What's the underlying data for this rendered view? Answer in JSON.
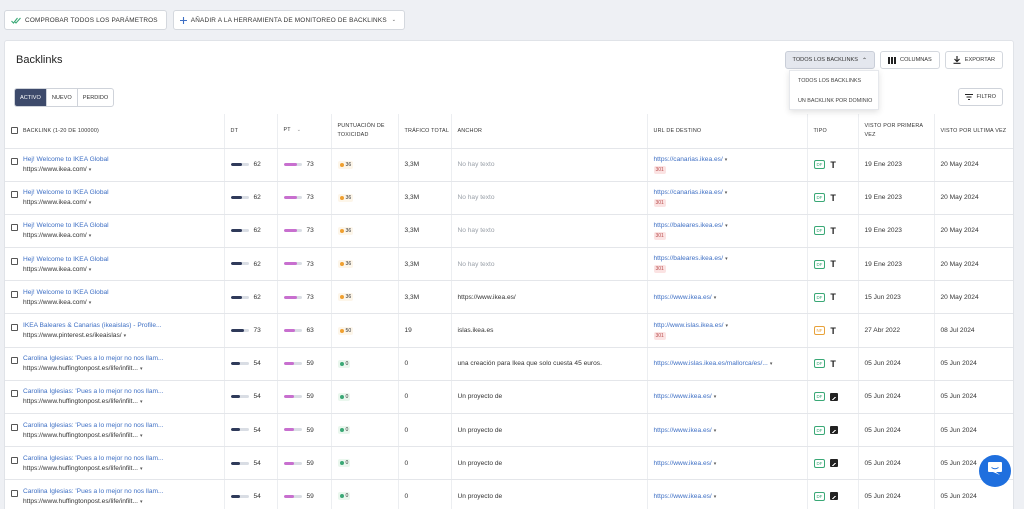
{
  "toolbar": {
    "check_params": "Comprobar todos los parámetros",
    "add_monitor": "Añadir a la herramienta de monitoreo de backlinks"
  },
  "header": {
    "title": "Backlinks",
    "all_backlinks": "Todos los backlinks",
    "columns": "Columnas",
    "export": "Exportar"
  },
  "dropdown": {
    "items": [
      "Todos los backlinks",
      "Un backlink por dominio"
    ]
  },
  "tabs": [
    "Activo",
    "Nuevo",
    "Perdido"
  ],
  "filter_label": "Filtro",
  "columns": {
    "backlink": "Backlink (1-20 de 100000)",
    "dt": "DT",
    "pt": "PT",
    "toxicity": "Puntuación de toxicidad",
    "traffic": "Tráfico total",
    "anchor": "Anchor",
    "target": "URL de destino",
    "type": "Tipo",
    "first_seen": "Visto por primera vez",
    "last_seen": "Visto por ultima vez"
  },
  "colors": {
    "accent": "#3d4a6b",
    "link": "#3e6fc4",
    "dt_bar": "#2f3a5a",
    "pt_bar": "#c86fcf",
    "tox_orange": "#f0a030",
    "tox_green": "#3aa876",
    "chat": "#1f6fde"
  },
  "rows": [
    {
      "title": "Hej! Welcome to IKEA Global",
      "url": "https://www.ikea.com/",
      "dt": "62",
      "dt_level": 0.62,
      "pt": "73",
      "pt_level": 0.73,
      "tox": "36",
      "tox_color": "orange",
      "traffic": "3,3M",
      "anchor": "No hay texto",
      "anchor_muted": true,
      "target": "https://canarias.ikea.es/",
      "redirect": "301",
      "df": "DF",
      "nofollow": false,
      "icon": "text-icon",
      "first": "19 Ene 2023",
      "last": "20 May 2024"
    },
    {
      "title": "Hej! Welcome to IKEA Global",
      "url": "https://www.ikea.com/",
      "dt": "62",
      "dt_level": 0.62,
      "pt": "73",
      "pt_level": 0.73,
      "tox": "36",
      "tox_color": "orange",
      "traffic": "3,3M",
      "anchor": "No hay texto",
      "anchor_muted": true,
      "target": "https://canarias.ikea.es/",
      "redirect": "301",
      "df": "DF",
      "nofollow": false,
      "icon": "text-icon",
      "first": "19 Ene 2023",
      "last": "20 May 2024"
    },
    {
      "title": "Hej! Welcome to IKEA Global",
      "url": "https://www.ikea.com/",
      "dt": "62",
      "dt_level": 0.62,
      "pt": "73",
      "pt_level": 0.73,
      "tox": "36",
      "tox_color": "orange",
      "traffic": "3,3M",
      "anchor": "No hay texto",
      "anchor_muted": true,
      "target": "https://baleares.ikea.es/",
      "redirect": "301",
      "df": "DF",
      "nofollow": false,
      "icon": "text-icon",
      "first": "19 Ene 2023",
      "last": "20 May 2024"
    },
    {
      "title": "Hej! Welcome to IKEA Global",
      "url": "https://www.ikea.com/",
      "dt": "62",
      "dt_level": 0.62,
      "pt": "73",
      "pt_level": 0.73,
      "tox": "36",
      "tox_color": "orange",
      "traffic": "3,3M",
      "anchor": "No hay texto",
      "anchor_muted": true,
      "target": "https://baleares.ikea.es/",
      "redirect": "301",
      "df": "DF",
      "nofollow": false,
      "icon": "text-icon",
      "first": "19 Ene 2023",
      "last": "20 May 2024"
    },
    {
      "title": "Hej! Welcome to IKEA Global",
      "url": "https://www.ikea.com/",
      "dt": "62",
      "dt_level": 0.62,
      "pt": "73",
      "pt_level": 0.73,
      "tox": "36",
      "tox_color": "orange",
      "traffic": "3,3M",
      "anchor": "https://www.ikea.es/",
      "anchor_muted": false,
      "target": "https://www.ikea.es/",
      "redirect": "",
      "df": "DF",
      "nofollow": false,
      "icon": "text-icon",
      "first": "15 Jun 2023",
      "last": "20 May 2024"
    },
    {
      "title": "IKEA Baleares & Canarias (ikeaislas) - Profile...",
      "url": "https://www.pinterest.es/ikeaislas/",
      "dt": "73",
      "dt_level": 0.73,
      "pt": "63",
      "pt_level": 0.63,
      "tox": "50",
      "tox_color": "orange",
      "traffic": "19",
      "anchor": "islas.ikea.es",
      "anchor_muted": false,
      "target": "http://www.islas.ikea.es/",
      "redirect": "301",
      "df": "NF",
      "nofollow": true,
      "icon": "text-icon",
      "first": "27 Abr 2022",
      "last": "08 Jul 2024"
    },
    {
      "title": "Carolina Iglesias: 'Pues a lo mejor no nos llam...",
      "url": "https://www.huffingtonpost.es/life/infilt...",
      "dt": "54",
      "dt_level": 0.54,
      "pt": "59",
      "pt_level": 0.59,
      "tox": "0",
      "tox_color": "green",
      "traffic": "0",
      "anchor": "una creación para Ikea que solo cuesta 45 euros.",
      "anchor_muted": false,
      "target": "https://www.islas.ikea.es/mallorca/es/...",
      "redirect": "",
      "df": "DF",
      "nofollow": false,
      "icon": "text-icon",
      "first": "05 Jun 2024",
      "last": "05 Jun 2024"
    },
    {
      "title": "Carolina Iglesias: 'Pues a lo mejor no nos llam...",
      "url": "https://www.huffingtonpost.es/life/infilt...",
      "dt": "54",
      "dt_level": 0.54,
      "pt": "59",
      "pt_level": 0.59,
      "tox": "0",
      "tox_color": "green",
      "traffic": "0",
      "anchor": "Un proyecto de",
      "anchor_muted": false,
      "target": "https://www.ikea.es/",
      "redirect": "",
      "df": "DF",
      "nofollow": false,
      "icon": "image-icon",
      "first": "05 Jun 2024",
      "last": "05 Jun 2024"
    },
    {
      "title": "Carolina Iglesias: 'Pues a lo mejor no nos llam...",
      "url": "https://www.huffingtonpost.es/life/infilt...",
      "dt": "54",
      "dt_level": 0.54,
      "pt": "59",
      "pt_level": 0.59,
      "tox": "0",
      "tox_color": "green",
      "traffic": "0",
      "anchor": "Un proyecto de",
      "anchor_muted": false,
      "target": "https://www.ikea.es/",
      "redirect": "",
      "df": "DF",
      "nofollow": false,
      "icon": "image-icon",
      "first": "05 Jun 2024",
      "last": "05 Jun 2024"
    },
    {
      "title": "Carolina Iglesias: 'Pues a lo mejor no nos llam...",
      "url": "https://www.huffingtonpost.es/life/infilt...",
      "dt": "54",
      "dt_level": 0.54,
      "pt": "59",
      "pt_level": 0.59,
      "tox": "0",
      "tox_color": "green",
      "traffic": "0",
      "anchor": "Un proyecto de",
      "anchor_muted": false,
      "target": "https://www.ikea.es/",
      "redirect": "",
      "df": "DF",
      "nofollow": false,
      "icon": "image-icon",
      "first": "05 Jun 2024",
      "last": "05 Jun 2024"
    },
    {
      "title": "Carolina Iglesias: 'Pues a lo mejor no nos llam...",
      "url": "https://www.huffingtonpost.es/life/infilt...",
      "dt": "54",
      "dt_level": 0.54,
      "pt": "59",
      "pt_level": 0.59,
      "tox": "0",
      "tox_color": "green",
      "traffic": "0",
      "anchor": "Un proyecto de",
      "anchor_muted": false,
      "target": "https://www.ikea.es/",
      "redirect": "",
      "df": "DF",
      "nofollow": false,
      "icon": "image-icon",
      "first": "05 Jun 2024",
      "last": "05 Jun 2024"
    }
  ]
}
